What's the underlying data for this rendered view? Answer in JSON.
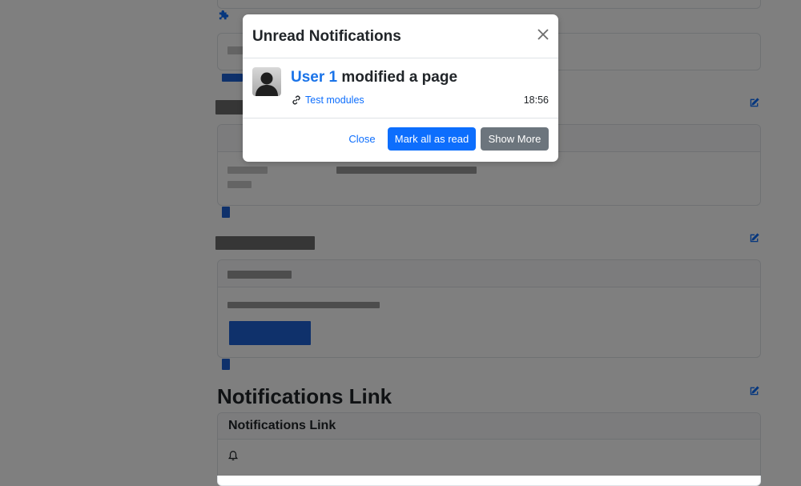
{
  "background": {
    "section_title": "Notifications Link",
    "card_header": "Notifications Link"
  },
  "modal": {
    "title": "Unread Notifications",
    "close_icon": "close-icon",
    "notification": {
      "user": "User 1",
      "action": " modified a page",
      "link_text": "Test modules",
      "time": "18:56"
    },
    "buttons": {
      "close": "Close",
      "mark_all": "Mark all as read",
      "show_more": "Show More"
    }
  },
  "colors": {
    "primary": "#0d6efd",
    "secondary": "#6c757d"
  }
}
